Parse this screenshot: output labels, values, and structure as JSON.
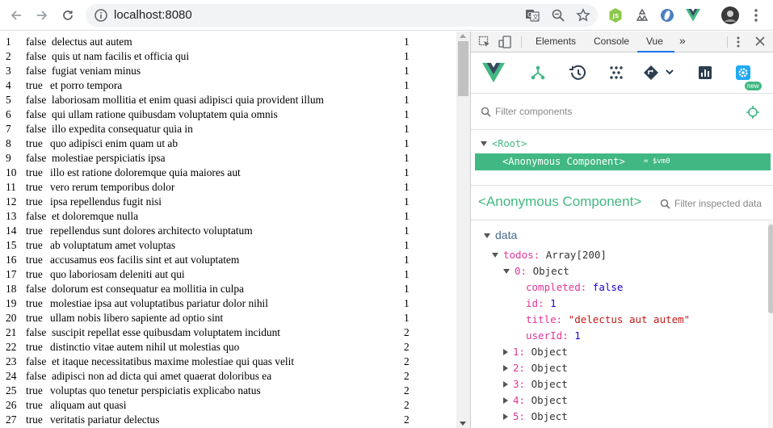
{
  "browser": {
    "url": "localhost:8080",
    "icons": [
      "back-arrow-icon",
      "forward-arrow-icon",
      "reload-icon",
      "info-icon",
      "translate-icon",
      "zoom-icon",
      "star-icon",
      "nodejs-extension-icon",
      "recycle-extension-icon",
      "blue-extension-icon",
      "vue-extension-icon",
      "profile-avatar",
      "kebab-menu-icon"
    ],
    "colors": {
      "toolbar_bg": "#ffffff",
      "omnibox_bg": "#f1f3f4"
    }
  },
  "todos": [
    {
      "id": "1",
      "completed": "false",
      "title": "delectus aut autem",
      "userId": "1"
    },
    {
      "id": "2",
      "completed": "false",
      "title": "quis ut nam facilis et officia qui",
      "userId": "1"
    },
    {
      "id": "3",
      "completed": "false",
      "title": "fugiat veniam minus",
      "userId": "1"
    },
    {
      "id": "4",
      "completed": "true",
      "title": "et porro tempora",
      "userId": "1"
    },
    {
      "id": "5",
      "completed": "false",
      "title": "laboriosam mollitia et enim quasi adipisci quia provident illum",
      "userId": "1"
    },
    {
      "id": "6",
      "completed": "false",
      "title": "qui ullam ratione quibusdam voluptatem quia omnis",
      "userId": "1"
    },
    {
      "id": "7",
      "completed": "false",
      "title": "illo expedita consequatur quia in",
      "userId": "1"
    },
    {
      "id": "8",
      "completed": "true",
      "title": "quo adipisci enim quam ut ab",
      "userId": "1"
    },
    {
      "id": "9",
      "completed": "false",
      "title": "molestiae perspiciatis ipsa",
      "userId": "1"
    },
    {
      "id": "10",
      "completed": "true",
      "title": "illo est ratione doloremque quia maiores aut",
      "userId": "1"
    },
    {
      "id": "11",
      "completed": "true",
      "title": "vero rerum temporibus dolor",
      "userId": "1"
    },
    {
      "id": "12",
      "completed": "true",
      "title": "ipsa repellendus fugit nisi",
      "userId": "1"
    },
    {
      "id": "13",
      "completed": "false",
      "title": "et doloremque nulla",
      "userId": "1"
    },
    {
      "id": "14",
      "completed": "true",
      "title": "repellendus sunt dolores architecto voluptatum",
      "userId": "1"
    },
    {
      "id": "15",
      "completed": "true",
      "title": "ab voluptatum amet voluptas",
      "userId": "1"
    },
    {
      "id": "16",
      "completed": "true",
      "title": "accusamus eos facilis sint et aut voluptatem",
      "userId": "1"
    },
    {
      "id": "17",
      "completed": "true",
      "title": "quo laboriosam deleniti aut qui",
      "userId": "1"
    },
    {
      "id": "18",
      "completed": "false",
      "title": "dolorum est consequatur ea mollitia in culpa",
      "userId": "1"
    },
    {
      "id": "19",
      "completed": "true",
      "title": "molestiae ipsa aut voluptatibus pariatur dolor nihil",
      "userId": "1"
    },
    {
      "id": "20",
      "completed": "true",
      "title": "ullam nobis libero sapiente ad optio sint",
      "userId": "1"
    },
    {
      "id": "21",
      "completed": "false",
      "title": "suscipit repellat esse quibusdam voluptatem incidunt",
      "userId": "2"
    },
    {
      "id": "22",
      "completed": "true",
      "title": "distinctio vitae autem nihil ut molestias quo",
      "userId": "2"
    },
    {
      "id": "23",
      "completed": "false",
      "title": "et itaque necessitatibus maxime molestiae qui quas velit",
      "userId": "2"
    },
    {
      "id": "24",
      "completed": "false",
      "title": "adipisci non ad dicta qui amet quaerat doloribus ea",
      "userId": "2"
    },
    {
      "id": "25",
      "completed": "true",
      "title": "voluptas quo tenetur perspiciatis explicabo natus",
      "userId": "2"
    },
    {
      "id": "26",
      "completed": "true",
      "title": "aliquam aut quasi",
      "userId": "2"
    },
    {
      "id": "27",
      "completed": "true",
      "title": "veritatis pariatur delectus",
      "userId": "2"
    }
  ],
  "devtools": {
    "tabs": [
      "Elements",
      "Console",
      "Vue"
    ],
    "active_tab": "Vue",
    "more_tabs": "»",
    "vue_toolbar_icons": [
      "vue-logo-icon",
      "components-icon",
      "timeline-icon",
      "vuex-icon",
      "routing-icon",
      "performance-icon",
      "settings-icon"
    ],
    "new_badge": "new",
    "filter_components_placeholder": "Filter components",
    "root_label": "<Root>",
    "selected_component": "<Anonymous Component>",
    "selected_vm": "= $vm0",
    "inspected_component": "<Anonymous Component>",
    "filter_inspected_placeholder": "Filter inspected data",
    "section": "data",
    "todos_key": "todos:",
    "todos_value": "Array[200]",
    "item0_key": "0:",
    "item0_type": "Object",
    "fields": [
      {
        "key": "completed:",
        "value": "false",
        "kind": "bool"
      },
      {
        "key": "id:",
        "value": "1",
        "kind": "num"
      },
      {
        "key": "title:",
        "value": "\"delectus aut autem\"",
        "kind": "str"
      },
      {
        "key": "userId:",
        "value": "1",
        "kind": "num"
      }
    ],
    "collapsed_items": [
      {
        "key": "1:",
        "type": "Object"
      },
      {
        "key": "2:",
        "type": "Object"
      },
      {
        "key": "3:",
        "type": "Object"
      },
      {
        "key": "4:",
        "type": "Object"
      },
      {
        "key": "5:",
        "type": "Object"
      }
    ],
    "colors": {
      "vue_green": "#41b883",
      "vue_dark": "#35495e",
      "active_tab_underline": "#1a73e8"
    }
  }
}
